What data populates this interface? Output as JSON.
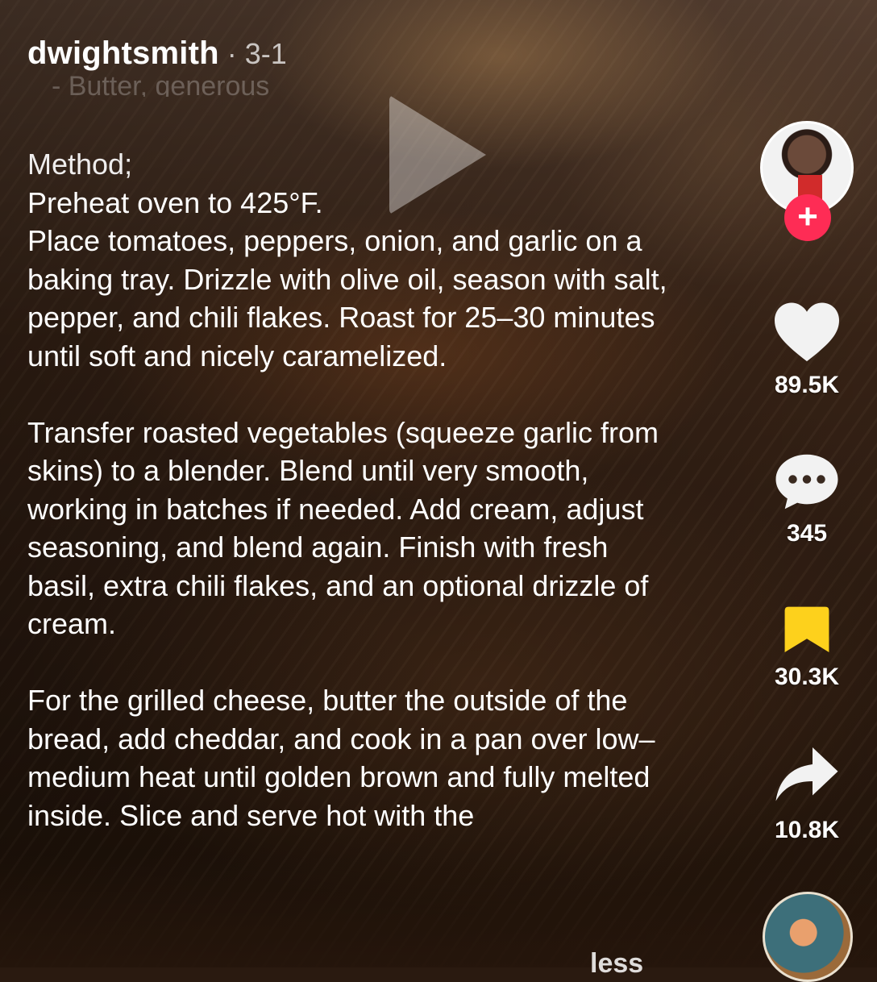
{
  "header": {
    "username": "dwightsmith",
    "date": "· 3-1",
    "faded_previous_line": "- Butter, generous"
  },
  "caption": {
    "heading": "Method;",
    "step1_line1": "Preheat oven to 425°F.",
    "step1_paragraph": "Place tomatoes, peppers, onion, and garlic on a baking tray. Drizzle with olive oil, season with salt, pepper, and chili flakes. Roast for 25–30 minutes until soft and nicely caramelized.",
    "step2_paragraph": "Transfer roasted vegetables (squeeze garlic from skins) to a blender. Blend until very smooth, working in batches if needed. Add cream, adjust seasoning, and blend again. Finish with fresh basil, extra chili flakes, and an optional drizzle of cream.",
    "step3_paragraph": "For the grilled cheese, butter the outside of the bread, add cheddar, and cook in a pan over low–medium heat until golden brown and fully melted inside. Slice and serve hot with the",
    "less_label": "less"
  },
  "rail": {
    "follow_symbol": "+",
    "likes": "89.5K",
    "comments": "345",
    "saves": "30.3K",
    "shares": "10.8K"
  },
  "icons": {
    "play": "play-icon",
    "like": "heart-icon",
    "comment": "comment-bubble-icon",
    "save": "bookmark-icon",
    "share": "share-arrow-icon",
    "follow": "plus-icon"
  },
  "colors": {
    "follow_button": "#fe2c55",
    "bookmark_active": "#fdd11c",
    "text": "#ffffff"
  }
}
